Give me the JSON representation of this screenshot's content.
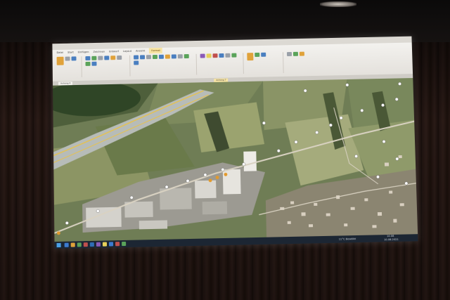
{
  "scene": {
    "description_items": [
      "ceiling-light",
      "curtain",
      "projection-screen"
    ]
  },
  "app": {
    "ribbon_tabs": [
      "Datei",
      "Start",
      "Einfügen",
      "Zeichnen",
      "Entwurf",
      "Layout",
      "Ansicht",
      "Format"
    ],
    "active_tab": "Format",
    "doc_tabs": [
      "Anhang 4",
      "Anhang 7"
    ]
  },
  "taskbar": {
    "weather": "11°C  Bewölkt",
    "clock": "14:08",
    "date": "10.08.2021"
  },
  "colors": {
    "curtain": "#3b2620",
    "screen_frame": "#e9e6e1",
    "map_field": "#6f7d55",
    "road": "#d9d2c2",
    "highway_marking": "#e8c24a",
    "marker_white": "#ffffff",
    "marker_orange": "#e39a2c",
    "taskbar": "#1c2633"
  }
}
